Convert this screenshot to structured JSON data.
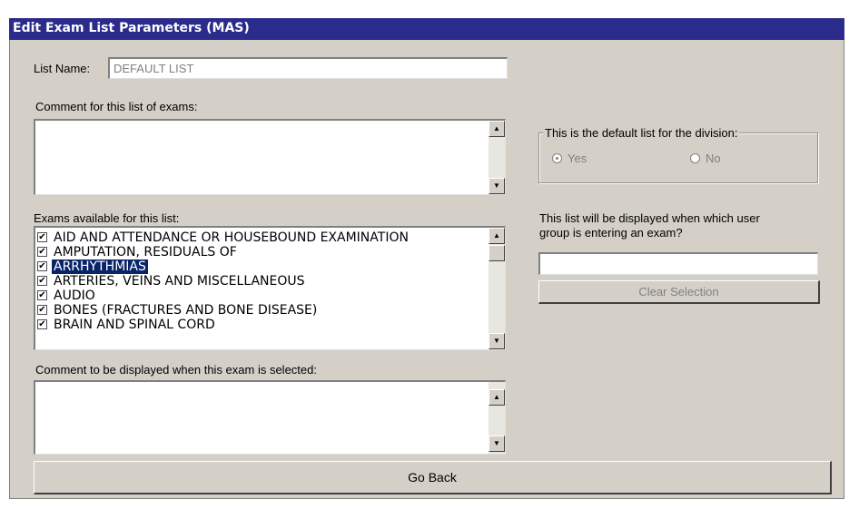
{
  "window": {
    "title": "Edit Exam List Parameters (MAS)"
  },
  "list_name": {
    "label": "List Name:",
    "value": "DEFAULT LIST"
  },
  "comment": {
    "label": "Comment for this list of exams:",
    "value": ""
  },
  "default_group": {
    "legend": "This is the default list for the division:",
    "options": [
      {
        "label": "Yes",
        "selected": true
      },
      {
        "label": "No",
        "selected": false
      }
    ]
  },
  "exams": {
    "label": "Exams available for this list:",
    "items": [
      {
        "label": "AID AND ATTENDANCE OR HOUSEBOUND EXAMINATION",
        "checked": true,
        "selected": false
      },
      {
        "label": "AMPUTATION, RESIDUALS OF",
        "checked": true,
        "selected": false
      },
      {
        "label": "ARRHYTHMIAS",
        "checked": true,
        "selected": true
      },
      {
        "label": "ARTERIES, VEINS AND MISCELLANEOUS",
        "checked": true,
        "selected": false
      },
      {
        "label": "AUDIO",
        "checked": true,
        "selected": false
      },
      {
        "label": "BONES (FRACTURES AND BONE DISEASE)",
        "checked": true,
        "selected": false
      },
      {
        "label": "BRAIN AND SPINAL CORD",
        "checked": true,
        "selected": false
      }
    ]
  },
  "user_group": {
    "label_line1": "This list will be displayed when which user",
    "label_line2": "group is entering an exam?",
    "value": "",
    "clear_label": "Clear Selection"
  },
  "exam_comment": {
    "label": "Comment to be displayed when this exam is selected:",
    "value": ""
  },
  "go_back_label": "Go Back",
  "icons": {
    "scroll_up": "▲",
    "scroll_down": "▼",
    "check": "✔"
  },
  "colors": {
    "titlebar": "#2b2b8c",
    "selection": "#0a246a",
    "face": "#d4d0c8"
  }
}
